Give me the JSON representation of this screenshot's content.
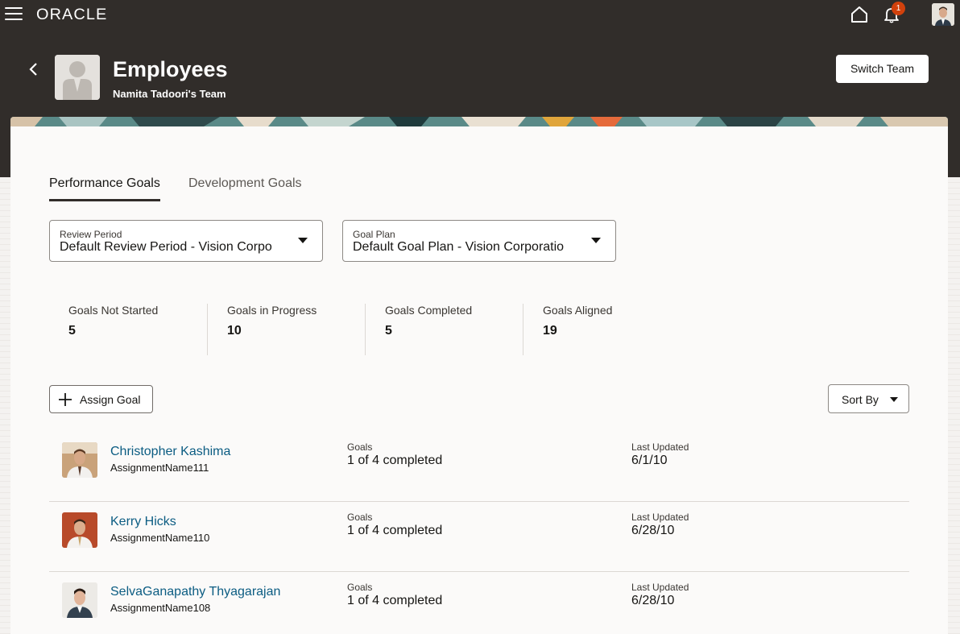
{
  "topbar": {
    "logo": "ORACLE",
    "notification_count": "1",
    "accent": "#d1410c"
  },
  "header": {
    "title": "Employees",
    "subtitle": "Namita Tadoori's Team",
    "switch_team_label": "Switch Team"
  },
  "tabs": [
    {
      "label": "Performance Goals",
      "active": true
    },
    {
      "label": "Development Goals",
      "active": false
    }
  ],
  "filters": {
    "review_period": {
      "label": "Review Period",
      "value": "Default Review Period - Vision Corpo"
    },
    "goal_plan": {
      "label": "Goal Plan",
      "value": "Default Goal Plan - Vision Corporatio"
    }
  },
  "stats": [
    {
      "label": "Goals Not Started",
      "value": "5"
    },
    {
      "label": "Goals in Progress",
      "value": "10"
    },
    {
      "label": "Goals Completed",
      "value": "5"
    },
    {
      "label": "Goals Aligned",
      "value": "19"
    }
  ],
  "actions": {
    "assign_goal_label": "Assign Goal",
    "sort_by_label": "Sort By"
  },
  "employees": [
    {
      "name": "Christopher Kashima",
      "assignment": "AssignmentName111",
      "goals_label": "Goals",
      "goals_value": "1 of 4 completed",
      "updated_label": "Last Updated",
      "updated_value": "6/1/10"
    },
    {
      "name": "Kerry Hicks",
      "assignment": "AssignmentName110",
      "goals_label": "Goals",
      "goals_value": "1 of 4 completed",
      "updated_label": "Last Updated",
      "updated_value": "6/28/10"
    },
    {
      "name": "SelvaGanapathy Thyagarajan",
      "assignment": "AssignmentName108",
      "goals_label": "Goals",
      "goals_value": "1 of 4 completed",
      "updated_label": "Last Updated",
      "updated_value": "6/28/10"
    }
  ]
}
